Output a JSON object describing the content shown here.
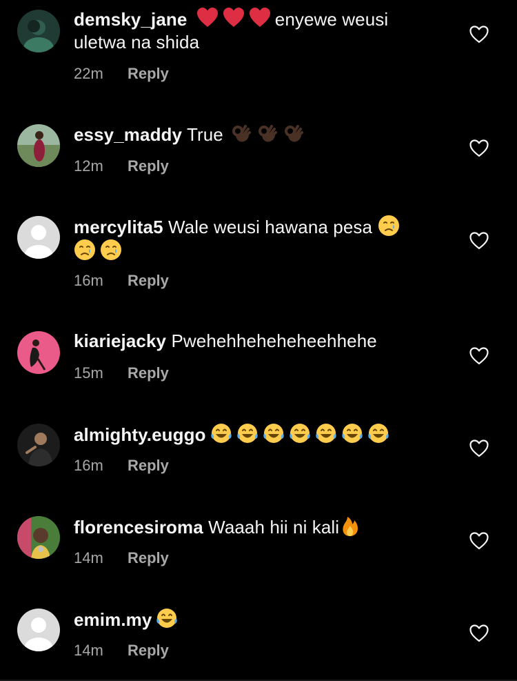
{
  "comments": [
    {
      "username": "demsky_jane",
      "text_after_emoji": "enyewe weusi",
      "text_line2": "uletwa na shida",
      "time": "22m",
      "reply": "Reply",
      "emojis": [
        "red-heart",
        "red-heart",
        "red-heart"
      ],
      "avatar": "photo-green"
    },
    {
      "username": "essy_maddy",
      "text": "True",
      "time": "12m",
      "reply": "Reply",
      "emojis": [
        "ok-hand-dark",
        "ok-hand-dark",
        "ok-hand-dark"
      ],
      "avatar": "photo-outdoor"
    },
    {
      "username": "mercylita5",
      "text": "Wale weusi hawana pesa",
      "time": "16m",
      "reply": "Reply",
      "emojis": [
        "crying-face",
        "crying-face",
        "crying-face"
      ],
      "avatar": "default-avatar"
    },
    {
      "username": "kiariejacky",
      "text": "Pwehehheheheheehhehe",
      "time": "15m",
      "reply": "Reply",
      "avatar": "photo-pink"
    },
    {
      "username": "almighty.euggo",
      "time": "16m",
      "reply": "Reply",
      "emojis": [
        "tears-of-joy",
        "tears-of-joy",
        "tears-of-joy",
        "tears-of-joy",
        "tears-of-joy",
        "tears-of-joy",
        "tears-of-joy"
      ],
      "avatar": "photo-dark"
    },
    {
      "username": "florencesiroma",
      "text": "Waaah hii ni kali",
      "time": "14m",
      "reply": "Reply",
      "emojis": [
        "fire"
      ],
      "avatar": "photo-colorful"
    },
    {
      "username": "emim.my",
      "time": "14m",
      "reply": "Reply",
      "emojis": [
        "tears-of-joy"
      ],
      "avatar": "default-avatar"
    }
  ],
  "icons": {
    "like": "heart-outline-icon"
  },
  "colors": {
    "background": "#000000",
    "text": "#f5f5f5",
    "secondary": "#a8a8a8",
    "heart_emoji": "#e0245e"
  }
}
